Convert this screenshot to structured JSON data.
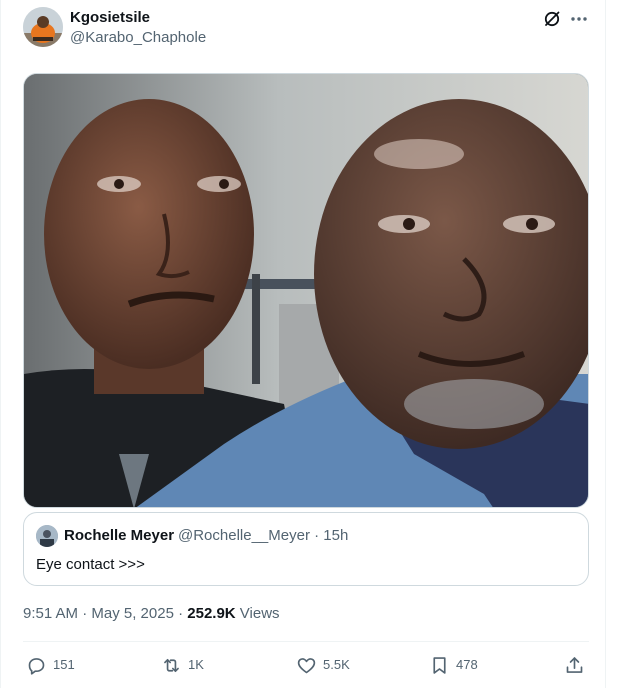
{
  "post": {
    "author": {
      "name": "Kgosietsile",
      "handle": "@Karabo_Chaphole"
    },
    "media": {
      "description_icon": "photo"
    },
    "quote": {
      "author": "Rochelle Meyer",
      "meta": "@Rochelle__Meyer · 15h",
      "text": "Eye contact >>>"
    },
    "time": "9:51 AM · May 5, 2025",
    "separator": " · ",
    "views_count": "252.9K",
    "views_label": " Views",
    "actions": {
      "replies": "151",
      "reposts": "1K",
      "likes": "5.5K",
      "bookmarks": "478"
    }
  },
  "icons": {
    "grok": "grok-icon",
    "more": "more-icon",
    "reply": "reply-icon",
    "repost": "repost-icon",
    "like": "heart-icon",
    "bookmark": "bookmark-icon",
    "share": "share-icon"
  },
  "colors": {
    "text_primary": "#0f1419",
    "text_secondary": "#536471",
    "border": "#cfd9de"
  }
}
